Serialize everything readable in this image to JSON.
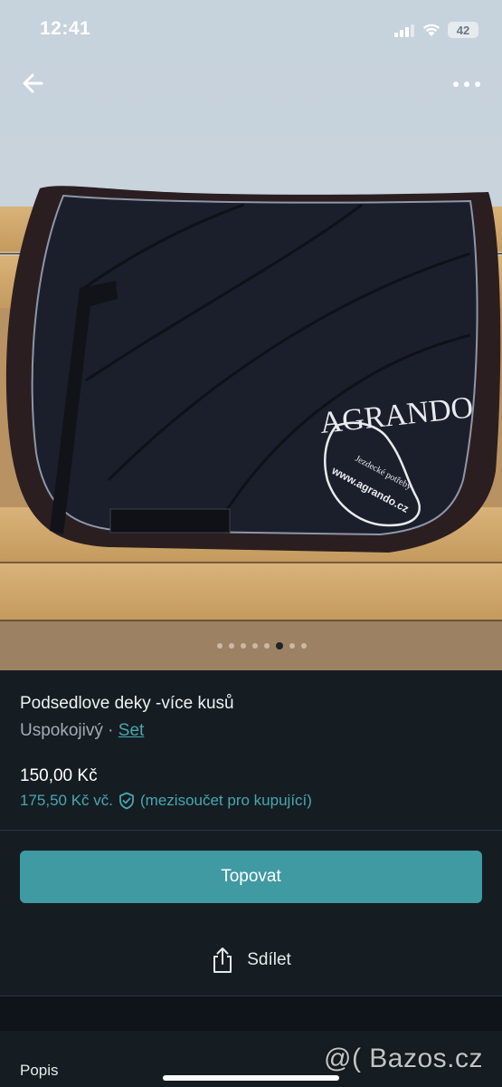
{
  "status_bar": {
    "time": "12:41",
    "battery": "42"
  },
  "photo": {
    "logo_text": "AGRANDO",
    "logo_tagline": "Jezdecké potřeby",
    "logo_url": "www.agrando.cz",
    "pager": {
      "count": 8,
      "active_index": 5
    }
  },
  "listing": {
    "title": "Podsedlove deky -více kusů",
    "condition": "Uspokojivý",
    "separator": " · ",
    "category_link": "Set",
    "price": "150,00 Kč",
    "price_total": "175,50 Kč vč.",
    "price_total_note": "(mezisoučet pro kupující)"
  },
  "actions": {
    "promote_label": "Topovat",
    "share_label": "Sdílet"
  },
  "sections": {
    "description_title": "Popis"
  },
  "watermark": "@( Bazos.cz",
  "colors": {
    "accent": "#3f9aa2",
    "link": "#47a7b0",
    "background": "#151d22"
  },
  "icons": {
    "back": "arrow-left-icon",
    "more": "more-horizontal-icon",
    "shield": "shield-check-icon",
    "share": "share-icon"
  }
}
